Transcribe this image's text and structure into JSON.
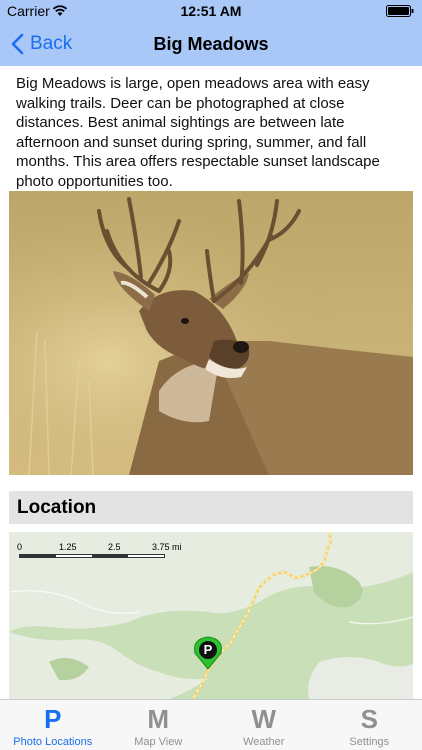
{
  "status": {
    "carrier": "Carrier",
    "time": "12:51 AM"
  },
  "nav": {
    "back_label": "Back",
    "title": "Big Meadows"
  },
  "description": "Big Meadows is large, open meadows area with easy walking trails.  Deer can be photographed at close distances.  Best animal sightings are between late afternoon and sunset during spring, summer, and fall months. This area offers respectable sunset landscape photo opportunities too.",
  "photo": {
    "subject": "white-tailed deer buck"
  },
  "location": {
    "title": "Location",
    "scale_labels": [
      "0",
      "1.25",
      "2.5",
      "3.75 mi"
    ],
    "marker_letter": "P"
  },
  "tabs": [
    {
      "letter": "P",
      "label": "Photo Locations",
      "active": true
    },
    {
      "letter": "M",
      "label": "Map View",
      "active": false
    },
    {
      "letter": "W",
      "label": "Weather",
      "active": false
    },
    {
      "letter": "S",
      "label": "Settings",
      "active": false
    }
  ],
  "colors": {
    "accent": "#1a6ff0",
    "bar": "#a9c8f7",
    "marker": "#2ec22e"
  }
}
